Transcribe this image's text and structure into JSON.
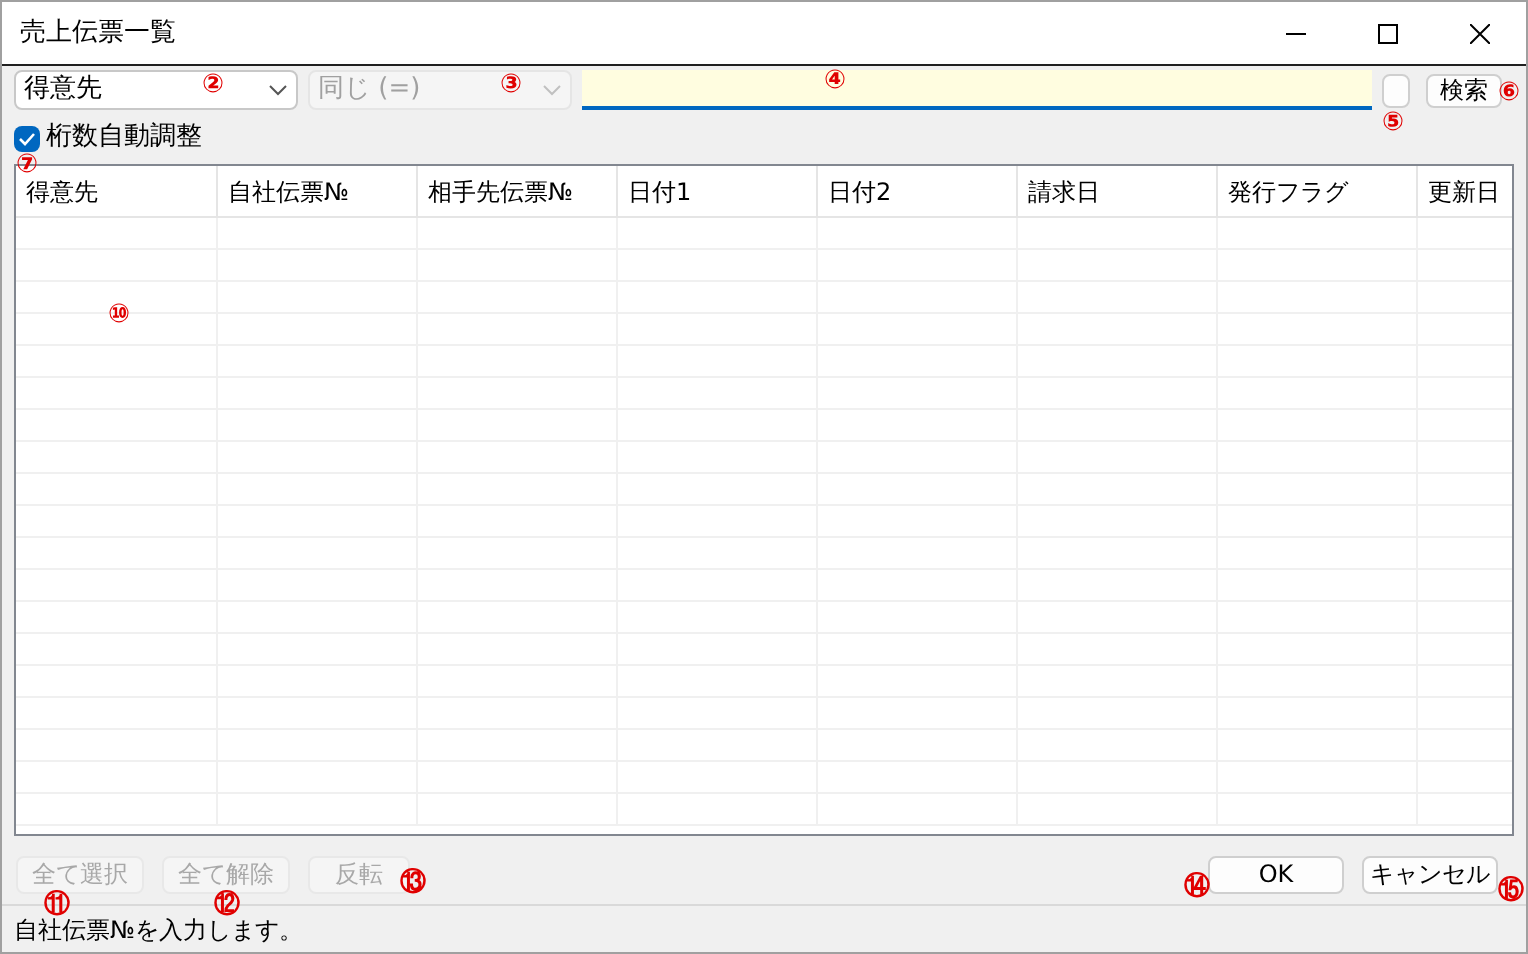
{
  "window": {
    "title": "売上伝票一覧"
  },
  "toolbar": {
    "field_select": {
      "value": "得意先",
      "disabled": false
    },
    "condition_select": {
      "value": "同じ (=)",
      "disabled": true
    },
    "search_input": {
      "focused": true
    },
    "search_button": {
      "label": "検索"
    }
  },
  "auto_adjust": {
    "label": "桁数自動調整",
    "checked": true
  },
  "table": {
    "columns": [
      "得意先",
      "自社伝票№",
      "相手先伝票№",
      "日付1",
      "日付2",
      "請求日",
      "発行フラグ",
      "更新日"
    ]
  },
  "selection_buttons": [
    {
      "label": "全て選択",
      "disabled": true
    },
    {
      "label": "全て解除",
      "disabled": true
    },
    {
      "label": "反転",
      "disabled": true
    }
  ],
  "dialog_buttons": [
    {
      "label": "OK",
      "disabled": false
    },
    {
      "label": "キャンセル",
      "disabled": false
    }
  ],
  "status_bar": {
    "text": "自社伝票№を入力します。"
  },
  "annotations": [
    {
      "text": "②"
    },
    {
      "text": "③"
    },
    {
      "text": "④"
    },
    {
      "text": "⑤"
    },
    {
      "text": "⑥"
    },
    {
      "text": "⑦"
    },
    {
      "text": "⑩"
    },
    {
      "text": "⑪"
    },
    {
      "text": "⑫"
    },
    {
      "text": "⑬"
    },
    {
      "text": "⑭"
    },
    {
      "text": "⑮"
    }
  ]
}
